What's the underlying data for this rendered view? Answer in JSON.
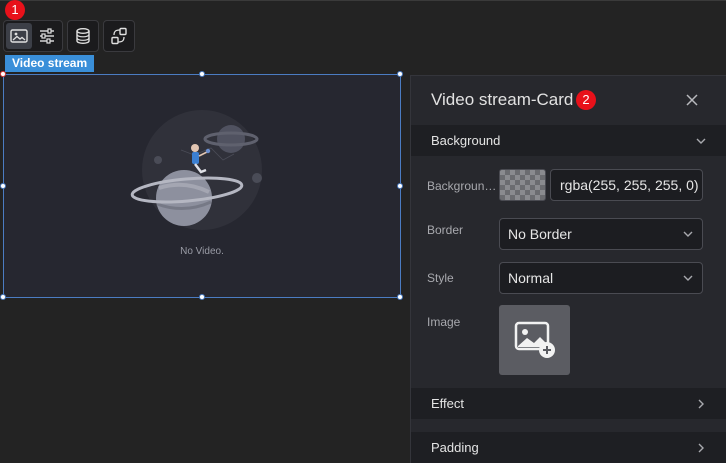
{
  "toolbar": {
    "buttons": [
      {
        "icon": "image-card-icon",
        "active": true
      },
      {
        "icon": "sliders-icon",
        "active": false
      },
      {
        "icon": "database-icon",
        "active": false
      },
      {
        "icon": "link-switch-icon",
        "active": false
      }
    ]
  },
  "badges": {
    "one": "1",
    "two": "2"
  },
  "canvas": {
    "component_label": "Video stream",
    "no_video_text": "No Video."
  },
  "panel": {
    "title": "Video stream-Card",
    "close_icon": "close-icon",
    "sections": {
      "background": "Background",
      "effect": "Effect",
      "padding": "Padding"
    },
    "background": {
      "color_label": "Background color",
      "color_value": "rgba(255, 255, 255, 0)",
      "border_label": "Border",
      "border_value": "No Border",
      "style_label": "Style",
      "style_value": "Normal",
      "image_label": "Image"
    }
  },
  "colors": {
    "accent_blue": "#3a8fd9",
    "badge_red": "#e8111a",
    "panel_bg": "#27282d"
  }
}
